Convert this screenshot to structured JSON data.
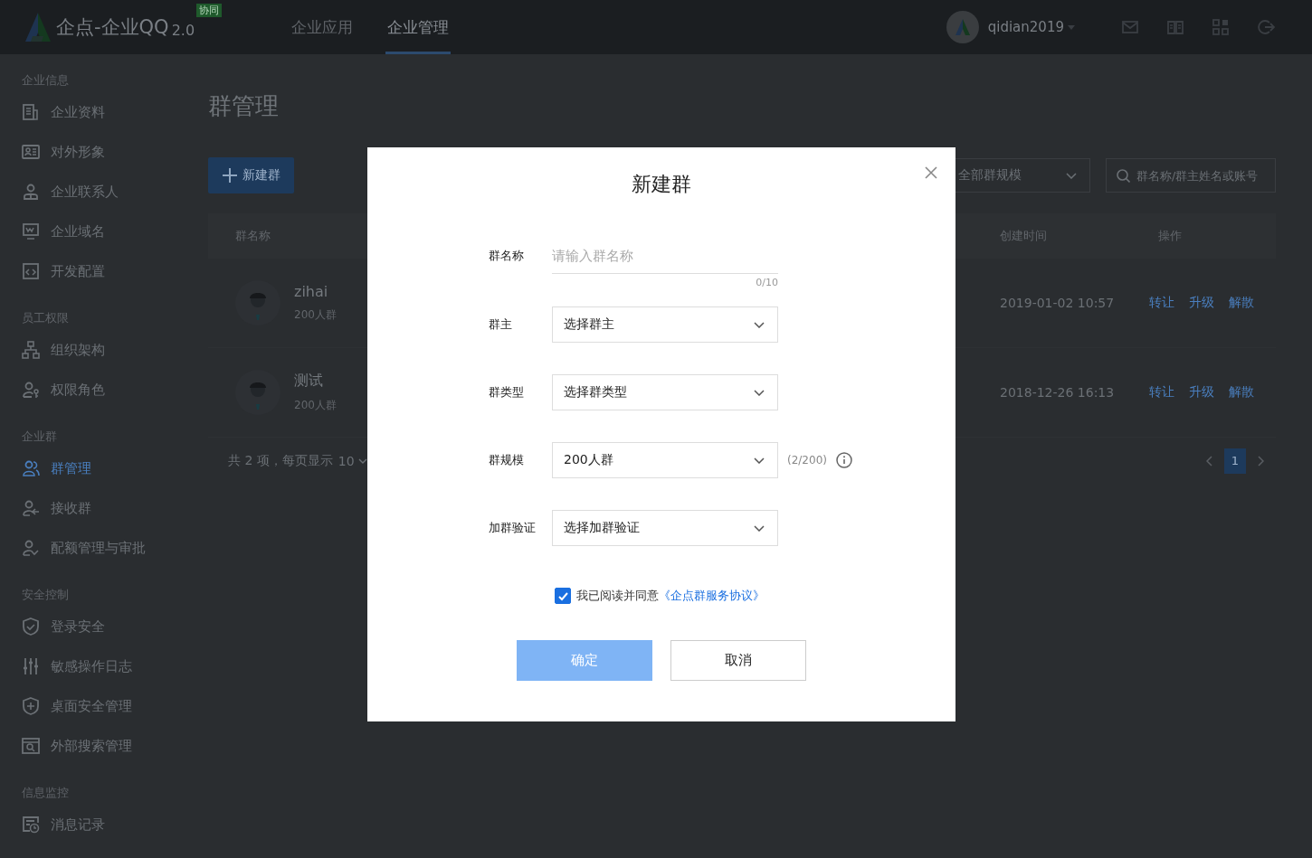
{
  "topbar": {
    "brand": "企点-企业QQ",
    "version": "2.0",
    "badge": "协同",
    "nav": [
      {
        "label": "企业应用",
        "selected": false
      },
      {
        "label": "企业管理",
        "selected": true
      }
    ],
    "user": "qidian2019"
  },
  "sidebar": {
    "sections": [
      {
        "title": "企业信息",
        "items": [
          {
            "label": "企业资料",
            "selected": false
          },
          {
            "label": "对外形象",
            "selected": false
          },
          {
            "label": "企业联系人",
            "selected": false
          },
          {
            "label": "企业域名",
            "selected": false
          },
          {
            "label": "开发配置",
            "selected": false
          }
        ]
      },
      {
        "title": "员工权限",
        "items": [
          {
            "label": "组织架构",
            "selected": false
          },
          {
            "label": "权限角色",
            "selected": false
          }
        ]
      },
      {
        "title": "企业群",
        "items": [
          {
            "label": "群管理",
            "selected": true
          },
          {
            "label": "接收群",
            "selected": false
          },
          {
            "label": "配额管理与审批",
            "selected": false
          }
        ]
      },
      {
        "title": "安全控制",
        "items": [
          {
            "label": "登录安全",
            "selected": false
          },
          {
            "label": "敏感操作日志",
            "selected": false
          },
          {
            "label": "桌面安全管理",
            "selected": false
          },
          {
            "label": "外部搜索管理",
            "selected": false
          }
        ]
      },
      {
        "title": "信息监控",
        "items": [
          {
            "label": "消息记录",
            "selected": false
          }
        ]
      }
    ]
  },
  "main": {
    "title": "群管理",
    "new_button": "新建群",
    "size_filter": "全部群规模",
    "search": {
      "placeholder": "群名称/群主姓名或账号"
    },
    "table": {
      "columns": [
        {
          "label": "群名称"
        },
        {
          "label": "创建时间"
        },
        {
          "label": "操作"
        }
      ],
      "rows": [
        {
          "name": "zihai",
          "size": "200人群",
          "created": "2019-01-02 10:57",
          "actions": [
            "转让",
            "升级",
            "解散"
          ]
        },
        {
          "name": "测试",
          "size": "200人群",
          "created": "2018-12-26 16:13",
          "actions": [
            "转让",
            "升级",
            "解散"
          ]
        }
      ]
    },
    "pagination": {
      "summary": "共 2 项，每页显示",
      "page_size": "10",
      "pages": [
        {
          "label": "1",
          "selected": true
        }
      ]
    }
  },
  "dialog": {
    "title": "新建群",
    "fields": [
      {
        "kind": "text",
        "label": "群名称",
        "placeholder": "请输入群名称",
        "counter": "0/10"
      },
      {
        "kind": "select",
        "label": "群主",
        "value": "选择群主"
      },
      {
        "kind": "select",
        "label": "群类型",
        "value": "选择群类型"
      },
      {
        "kind": "select",
        "label": "群规模",
        "value": "200人群",
        "note": "(2/200)"
      },
      {
        "kind": "select",
        "label": "加群验证",
        "value": "选择加群验证"
      }
    ],
    "agreement": {
      "checked": true,
      "text": "我已阅读并同意",
      "link": "《企点群服务协议》"
    },
    "buttons": [
      {
        "label": "确定",
        "kind": "primary",
        "disabled": true
      },
      {
        "label": "取消",
        "kind": "default",
        "disabled": false
      }
    ]
  }
}
